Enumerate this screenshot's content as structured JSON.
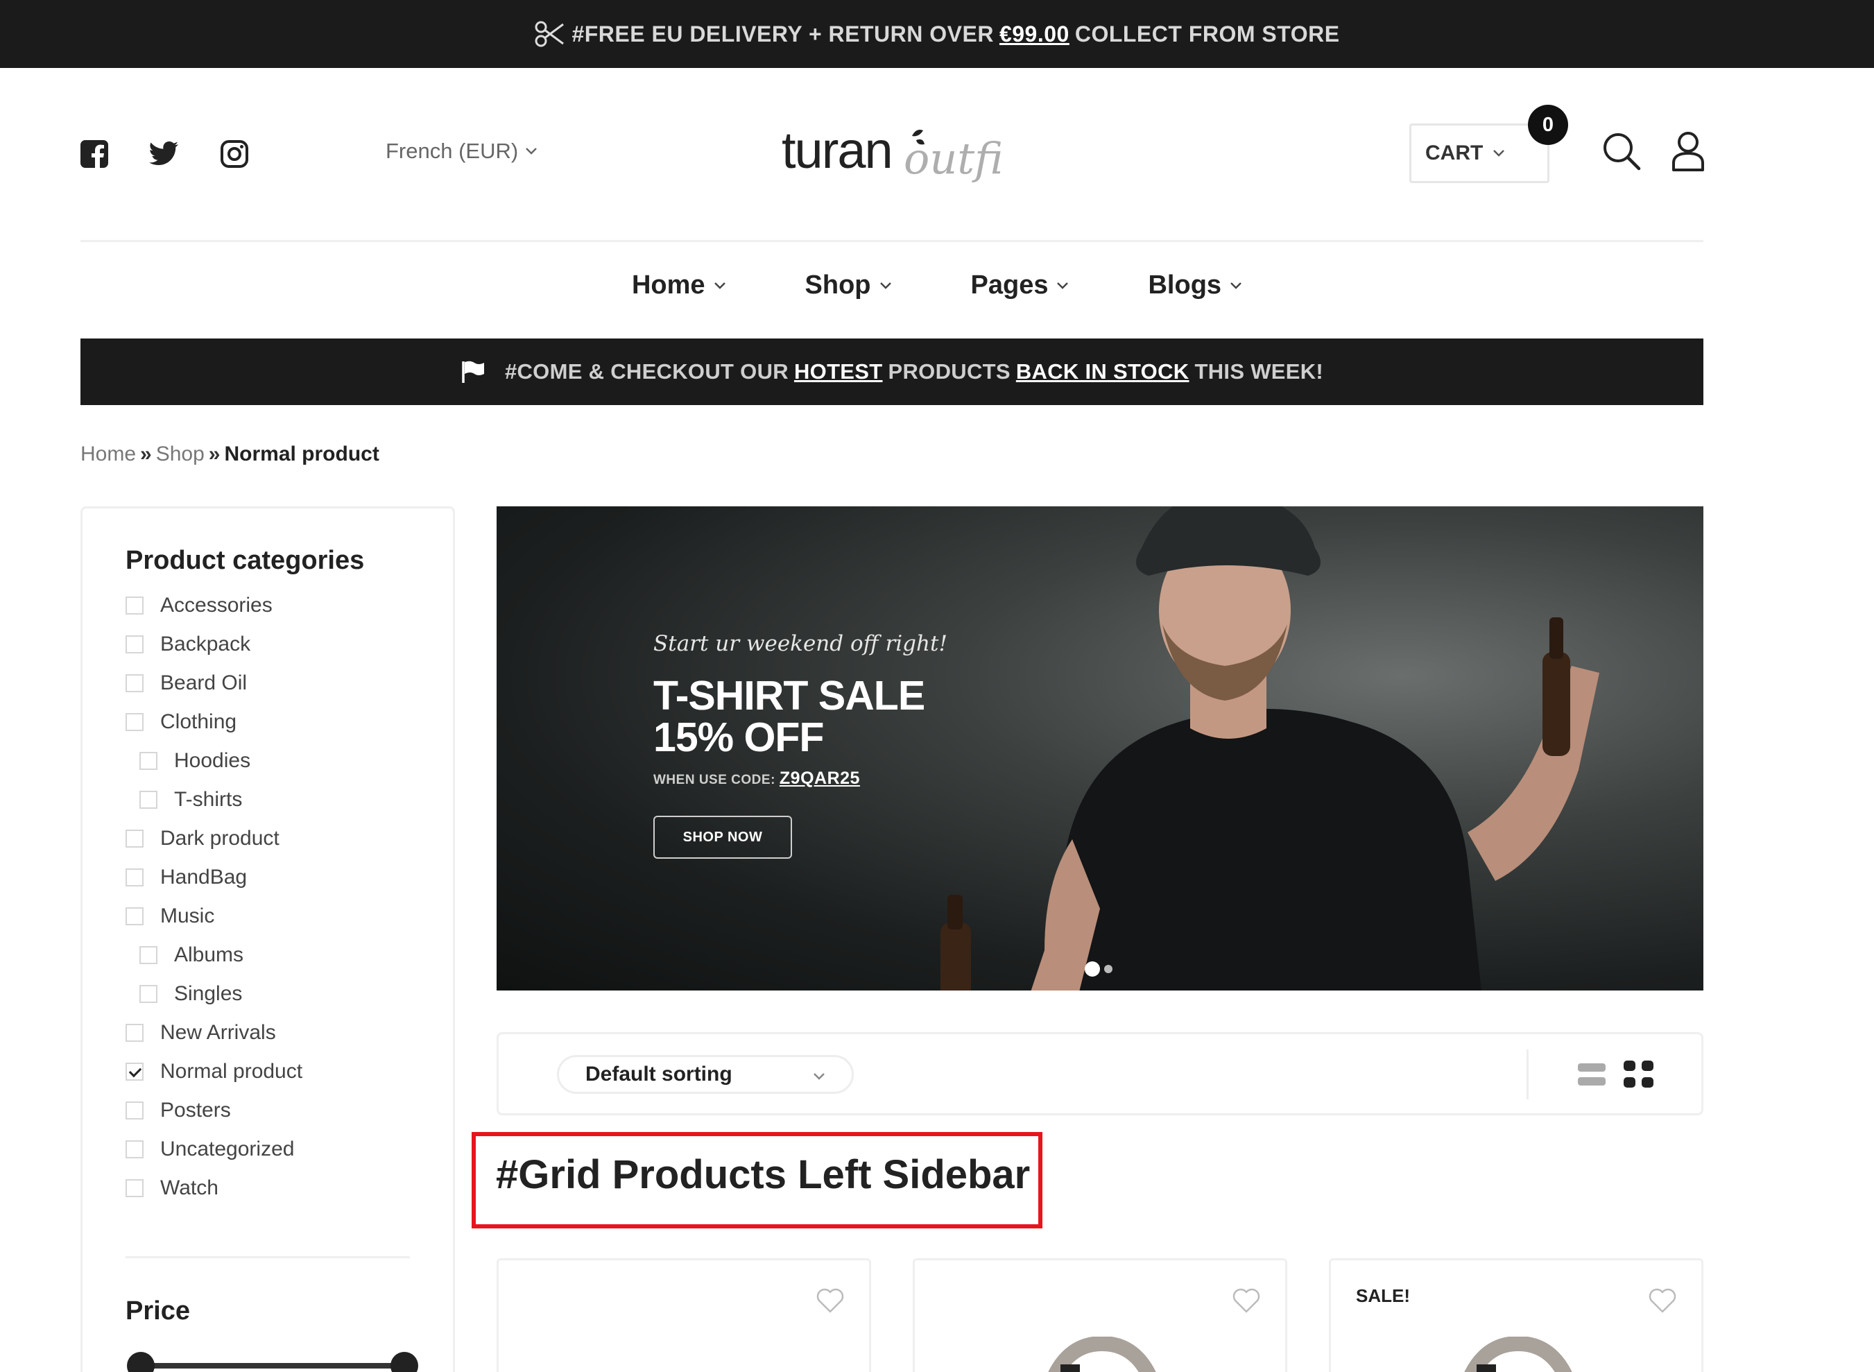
{
  "topbar": {
    "text_before": "#FREE EU DELIVERY + RETURN OVER",
    "amount": "€99.00",
    "text_after": "COLLECT FROM STORE",
    "icon": "scissors-icon"
  },
  "header": {
    "social_icons": [
      "facebook-icon",
      "twitter-icon",
      "instagram-icon"
    ],
    "currency": "French (EUR)",
    "logo_text_main": "turan",
    "logo_text_script": "outfit",
    "cart_label": "CART",
    "cart_count": "0",
    "icons": [
      "search-icon",
      "user-icon"
    ]
  },
  "nav": {
    "items": [
      {
        "label": "Home"
      },
      {
        "label": "Shop"
      },
      {
        "label": "Pages"
      },
      {
        "label": "Blogs"
      }
    ]
  },
  "promo": {
    "part1": "#COME & CHECKOUT OUR",
    "link1": "HOTEST",
    "part2": "PRODUCTS",
    "link2": "BACK IN STOCK",
    "part3": "THIS WEEK!",
    "icon": "flag-icon"
  },
  "breadcrumb": {
    "items": [
      "Home",
      "Shop"
    ],
    "current": "Normal product",
    "separator": "»"
  },
  "sidebar": {
    "categories_title": "Product categories",
    "categories": [
      {
        "label": "Accessories",
        "checked": false,
        "sub": false
      },
      {
        "label": "Backpack",
        "checked": false,
        "sub": false
      },
      {
        "label": "Beard Oil",
        "checked": false,
        "sub": false
      },
      {
        "label": "Clothing",
        "checked": false,
        "sub": false
      },
      {
        "label": "Hoodies",
        "checked": false,
        "sub": true
      },
      {
        "label": "T-shirts",
        "checked": false,
        "sub": true
      },
      {
        "label": "Dark product",
        "checked": false,
        "sub": false
      },
      {
        "label": "HandBag",
        "checked": false,
        "sub": false
      },
      {
        "label": "Music",
        "checked": false,
        "sub": false
      },
      {
        "label": "Albums",
        "checked": false,
        "sub": true
      },
      {
        "label": "Singles",
        "checked": false,
        "sub": true
      },
      {
        "label": "New Arrivals",
        "checked": false,
        "sub": false
      },
      {
        "label": "Normal product",
        "checked": true,
        "sub": false
      },
      {
        "label": "Posters",
        "checked": false,
        "sub": false
      },
      {
        "label": "Uncategorized",
        "checked": false,
        "sub": false
      },
      {
        "label": "Watch",
        "checked": false,
        "sub": false
      }
    ],
    "price_title": "Price"
  },
  "hero": {
    "script_text": "Start ur weekend off right!",
    "title_line1": "T-SHIRT SALE",
    "title_line2": "15% OFF",
    "code_label": "WHEN USE CODE:",
    "code": "Z9QAR25",
    "button_label": "SHOP NOW",
    "slides": 2,
    "active_slide": 1
  },
  "toolbar": {
    "sorting_value": "Default sorting",
    "view_modes": [
      "list-view-icon",
      "grid-view-icon"
    ],
    "active_view": "grid"
  },
  "section": {
    "heading": "#Grid Products Left Sidebar"
  },
  "products": [
    {
      "badge": "",
      "icon": "heart-icon"
    },
    {
      "badge": "",
      "icon": "heart-icon"
    },
    {
      "badge": "SALE!",
      "icon": "heart-icon"
    }
  ],
  "colors": {
    "dark_bar": "#1b1b1b",
    "highlight_border": "#e8141d",
    "text": "#222222",
    "muted": "#777777"
  }
}
